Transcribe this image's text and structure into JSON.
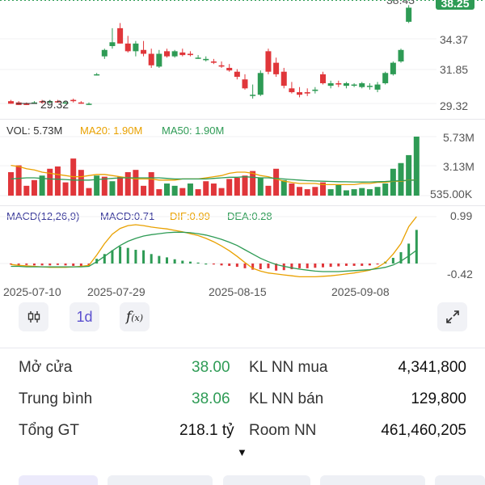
{
  "price_chart": {
    "y_labels": [
      "34.37",
      "31.85",
      "29.32"
    ],
    "last_price_tag": "38.25",
    "top_cut_label": "38.43",
    "low_marker": "29.32",
    "candles": [
      [
        29.5,
        29.6,
        29.3,
        29.3
      ],
      [
        29.4,
        29.5,
        29.2,
        29.2
      ],
      [
        29.3,
        29.4,
        29.2,
        29.2
      ],
      [
        29.4,
        29.5,
        29.3,
        29.4
      ],
      [
        29.5,
        29.6,
        29.3,
        29.4
      ],
      [
        29.4,
        29.6,
        29.3,
        29.5
      ],
      [
        29.5,
        29.6,
        29.4,
        29.4
      ],
      [
        29.4,
        29.5,
        29.3,
        29.4
      ],
      [
        29.6,
        29.7,
        29.4,
        29.5
      ],
      [
        29.4,
        29.5,
        29.3,
        29.3
      ],
      [
        29.3,
        29.4,
        29.2,
        29.3
      ],
      [
        31.6,
        31.7,
        31.5,
        31.6
      ],
      [
        33.0,
        33.6,
        32.8,
        33.5
      ],
      [
        33.8,
        35.2,
        33.6,
        34.1
      ],
      [
        35.2,
        35.6,
        34.0,
        34.0
      ],
      [
        34.0,
        34.6,
        33.3,
        33.4
      ],
      [
        33.4,
        34.2,
        33.0,
        34.0
      ],
      [
        33.5,
        34.2,
        33.0,
        33.2
      ],
      [
        33.2,
        33.6,
        32.1,
        32.3
      ],
      [
        32.2,
        33.5,
        32.1,
        33.2
      ],
      [
        33.4,
        33.6,
        32.9,
        33.0
      ],
      [
        33.0,
        33.5,
        32.9,
        33.4
      ],
      [
        33.3,
        33.6,
        33.0,
        33.1
      ],
      [
        33.2,
        33.4,
        33.0,
        33.1
      ],
      [
        32.9,
        33.1,
        32.8,
        32.9
      ],
      [
        32.7,
        33.0,
        32.6,
        32.8
      ],
      [
        32.6,
        32.8,
        32.4,
        32.5
      ],
      [
        32.3,
        32.6,
        32.1,
        32.2
      ],
      [
        32.1,
        32.4,
        31.8,
        31.9
      ],
      [
        31.8,
        32.0,
        31.2,
        31.4
      ],
      [
        31.2,
        31.6,
        30.4,
        30.5
      ],
      [
        30.0,
        30.8,
        29.7,
        30.0
      ],
      [
        30.0,
        31.9,
        29.9,
        31.7
      ],
      [
        33.4,
        33.6,
        31.6,
        31.8
      ],
      [
        32.5,
        32.9,
        31.4,
        31.6
      ],
      [
        31.8,
        32.1,
        30.5,
        30.7
      ],
      [
        30.5,
        31.0,
        30.1,
        30.2
      ],
      [
        30.2,
        30.6,
        29.8,
        30.0
      ],
      [
        30.2,
        30.5,
        29.9,
        30.1
      ],
      [
        30.3,
        30.6,
        30.1,
        30.4
      ],
      [
        31.6,
        31.8,
        30.8,
        30.9
      ],
      [
        30.7,
        31.1,
        30.5,
        30.9
      ],
      [
        30.9,
        31.1,
        30.6,
        30.8
      ],
      [
        30.7,
        31.0,
        30.5,
        30.9
      ],
      [
        30.8,
        30.9,
        30.6,
        30.8
      ],
      [
        30.6,
        31.0,
        30.5,
        30.9
      ],
      [
        30.7,
        30.9,
        30.4,
        30.7
      ],
      [
        30.4,
        31.0,
        30.2,
        30.8
      ],
      [
        30.9,
        31.8,
        30.8,
        31.7
      ],
      [
        31.6,
        32.6,
        31.5,
        32.5
      ],
      [
        32.6,
        33.6,
        32.5,
        33.5
      ],
      [
        35.7,
        37.0,
        35.6,
        36.8
      ],
      [
        38.0,
        38.6,
        37.6,
        38.2
      ]
    ]
  },
  "volume_chart": {
    "legend": {
      "vol": "VOL: 5.73M",
      "ma20": "MA20: 1.90M",
      "ma50": "MA50: 1.90M"
    },
    "y_labels": [
      "5.73M",
      "3.13M",
      "535.00K"
    ],
    "bars": [
      2.6,
      3.2,
      1.4,
      1.9,
      2.3,
      2.9,
      3.1,
      1.7,
      3.8,
      2.8,
      1.2,
      2.3,
      2.2,
      1.8,
      2.2,
      2.6,
      2.8,
      1.4,
      2.6,
      1.1,
      1.6,
      1.4,
      1.2,
      1.6,
      1.1,
      1.8,
      1.6,
      1.2,
      2.0,
      2.1,
      2.3,
      2.7,
      2.1,
      1.4,
      2.9,
      1.9,
      1.6,
      1.3,
      1.1,
      1.3,
      1.7,
      1.1,
      1.5,
      1.0,
      1.1,
      1.2,
      1.1,
      1.3,
      1.6,
      2.9,
      3.4,
      4.1,
      5.73
    ],
    "bar_colors": [
      "red",
      "red",
      "red",
      "red",
      "green",
      "red",
      "red",
      "red",
      "red",
      "red",
      "red",
      "green",
      "red",
      "green",
      "red",
      "red",
      "red",
      "red",
      "red",
      "red",
      "green",
      "green",
      "red",
      "green",
      "red",
      "red",
      "red",
      "red",
      "red",
      "red",
      "red",
      "red",
      "green",
      "red",
      "red",
      "green",
      "red",
      "red",
      "red",
      "red",
      "red",
      "green",
      "green",
      "green",
      "green",
      "green",
      "green",
      "green",
      "green",
      "green",
      "green",
      "green",
      "green"
    ],
    "ma20": [
      3.2,
      3.1,
      2.9,
      2.8,
      2.6,
      2.5,
      2.4,
      2.3,
      2.2,
      2.2,
      2.3,
      2.4,
      2.4,
      2.3,
      2.2,
      2.1,
      2.0,
      2.0,
      2.0,
      1.9,
      1.9,
      1.9,
      2.0,
      2.0,
      2.0,
      2.1,
      2.2,
      2.3,
      2.5,
      2.6,
      2.6,
      2.5,
      2.3,
      2.2,
      2.0,
      1.8,
      1.7,
      1.6,
      1.6,
      1.6,
      1.5,
      1.5,
      1.5,
      1.5,
      1.5,
      1.6,
      1.6,
      1.7,
      1.7,
      1.8,
      1.8,
      1.9,
      1.9
    ],
    "ma50": [
      2.0,
      2.05,
      2.1,
      2.1,
      2.05,
      2.0,
      1.98,
      1.95,
      1.9,
      1.9,
      1.9,
      1.95,
      2.0,
      2.05,
      2.1,
      2.1,
      2.1,
      2.1,
      2.1,
      2.1,
      2.05,
      2.0,
      2.0,
      2.0,
      2.0,
      2.0,
      2.05,
      2.1,
      2.15,
      2.15,
      2.2,
      2.15,
      2.1,
      2.1,
      2.05,
      2.0,
      1.95,
      1.9,
      1.85,
      1.82,
      1.8,
      1.78,
      1.76,
      1.75,
      1.74,
      1.73,
      1.74,
      1.76,
      1.78,
      1.82,
      1.85,
      1.88,
      1.9
    ]
  },
  "macd_chart": {
    "legend": {
      "params": "MACD(12,26,9)",
      "macd": "MACD:0.71",
      "dif": "DIF:0.99",
      "dea": "DEA:0.28"
    },
    "y_labels": [
      "0.99",
      "-0.42"
    ],
    "hist": [
      -0.02,
      -0.03,
      -0.03,
      -0.04,
      -0.04,
      -0.04,
      -0.03,
      -0.04,
      -0.05,
      -0.05,
      -0.04,
      0.1,
      0.2,
      0.28,
      0.36,
      0.33,
      0.29,
      0.28,
      0.2,
      0.16,
      0.13,
      0.09,
      0.06,
      0.04,
      0.02,
      0.0,
      -0.02,
      -0.04,
      -0.05,
      -0.07,
      -0.1,
      -0.13,
      -0.12,
      -0.1,
      -0.15,
      -0.14,
      -0.12,
      -0.1,
      -0.1,
      -0.09,
      -0.08,
      -0.07,
      -0.06,
      -0.05,
      -0.05,
      -0.05,
      -0.04,
      -0.02,
      0.04,
      0.12,
      0.24,
      0.42,
      0.71
    ],
    "dif": [
      -0.02,
      -0.04,
      -0.05,
      -0.06,
      -0.07,
      -0.08,
      -0.08,
      -0.08,
      -0.07,
      -0.06,
      -0.04,
      0.18,
      0.42,
      0.62,
      0.74,
      0.8,
      0.82,
      0.8,
      0.77,
      0.75,
      0.73,
      0.7,
      0.67,
      0.63,
      0.59,
      0.53,
      0.46,
      0.37,
      0.27,
      0.15,
      0.02,
      -0.1,
      -0.16,
      -0.2,
      -0.22,
      -0.24,
      -0.26,
      -0.28,
      -0.28,
      -0.28,
      -0.27,
      -0.26,
      -0.24,
      -0.22,
      -0.2,
      -0.17,
      -0.14,
      -0.08,
      0.02,
      0.2,
      0.42,
      0.78,
      0.99
    ],
    "dea": [
      -0.06,
      -0.06,
      -0.07,
      -0.07,
      -0.07,
      -0.07,
      -0.07,
      -0.07,
      -0.07,
      -0.07,
      -0.06,
      0.04,
      0.15,
      0.27,
      0.38,
      0.47,
      0.53,
      0.58,
      0.61,
      0.63,
      0.65,
      0.66,
      0.66,
      0.65,
      0.63,
      0.6,
      0.56,
      0.51,
      0.45,
      0.38,
      0.29,
      0.2,
      0.11,
      0.04,
      -0.02,
      -0.06,
      -0.09,
      -0.12,
      -0.14,
      -0.16,
      -0.17,
      -0.17,
      -0.17,
      -0.16,
      -0.15,
      -0.14,
      -0.13,
      -0.11,
      -0.08,
      -0.03,
      0.05,
      0.16,
      0.28
    ]
  },
  "x_axis": {
    "labels": [
      "2025-07-10",
      "2025-07-29",
      "2025-08-15",
      "2025-09-08"
    ]
  },
  "toolbar": {
    "interval_label": "1d",
    "candle_icon": "candlestick-icon",
    "fx_icon": "function-icon",
    "expand_icon": "expand-icon"
  },
  "stats": {
    "open_label": "Mở cửa",
    "open_value": "38.00",
    "avg_label": "Trung bình",
    "avg_value": "38.06",
    "total_label": "Tổng GT",
    "total_value": "218.1 tỷ",
    "buy_label": "KL NN mua",
    "buy_value": "4,341,800",
    "sell_label": "KL NN bán",
    "sell_value": "129,800",
    "room_label": "Room NN",
    "room_value": "461,460,205"
  },
  "colors": {
    "up": "#2e9b55",
    "down": "#e0363a",
    "ma20": "#e9a100",
    "ma50": "#2e9b55",
    "macd_label": "#3b3b9a",
    "accent_purple": "#5a4fcf"
  }
}
